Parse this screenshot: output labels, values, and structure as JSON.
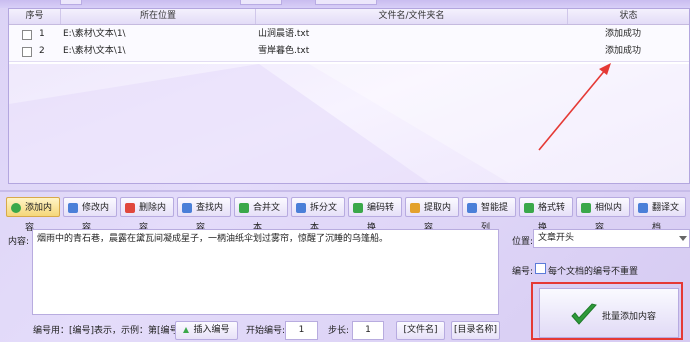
{
  "table": {
    "headers": {
      "index": "序号",
      "location": "所在位置",
      "filename": "文件名/文件夹名",
      "status": "状态"
    },
    "rows": [
      {
        "index": "1",
        "location": "E:\\素材\\文本\\1\\",
        "filename": "山涧晨语.txt",
        "status": "添加成功"
      },
      {
        "index": "2",
        "location": "E:\\素材\\文本\\1\\",
        "filename": "雪岸暮色.txt",
        "status": "添加成功"
      }
    ]
  },
  "toolbar": {
    "items": [
      {
        "label": "添加内容",
        "icon": "add-icon",
        "color": "#3aa84a"
      },
      {
        "label": "修改内容",
        "icon": "edit-icon",
        "color": "#4a7fd8"
      },
      {
        "label": "删除内容",
        "icon": "delete-icon",
        "color": "#e0473c"
      },
      {
        "label": "查找内容",
        "icon": "find-icon",
        "color": "#4a7fd8"
      },
      {
        "label": "合并文本",
        "icon": "merge-icon",
        "color": "#3aa84a"
      },
      {
        "label": "拆分文本",
        "icon": "split-icon",
        "color": "#4a7fd8"
      },
      {
        "label": "编码转换",
        "icon": "encode-icon",
        "color": "#3aa84a"
      },
      {
        "label": "提取内容",
        "icon": "extract-icon",
        "color": "#e3a12c"
      },
      {
        "label": "智能提列",
        "icon": "smart-icon",
        "color": "#4a7fd8"
      },
      {
        "label": "格式转换",
        "icon": "format-icon",
        "color": "#3aa84a"
      },
      {
        "label": "相似内容",
        "icon": "similar-icon",
        "color": "#3aa84a"
      },
      {
        "label": "翻译文档",
        "icon": "translate-icon",
        "color": "#4a7fd8"
      }
    ]
  },
  "content": {
    "label": "内容:",
    "text": "烟雨中的青石巷，晨露在黛瓦间凝成星子，一柄油纸伞划过雾帘，惊醒了沉睡的乌篷船。"
  },
  "position": {
    "label": "位置:",
    "value": "文章开头"
  },
  "numbering": {
    "label": "编号:",
    "checkbox_label": "每个文档的编号不重置"
  },
  "big_button": {
    "label": "批量添加内容",
    "icon": "checkmark-icon"
  },
  "bottom": {
    "hint": "编号用：[编号]表示，示例：第[编号]条",
    "insert_button": "插入编号",
    "start_label": "开始编号:",
    "start_value": "1",
    "step_label": "步长:",
    "step_value": "1",
    "filename_button": "[文件名]",
    "dirname_button": "[目录名称]"
  },
  "colors": {
    "accent": "#e53935",
    "success": "#3aa84a"
  }
}
